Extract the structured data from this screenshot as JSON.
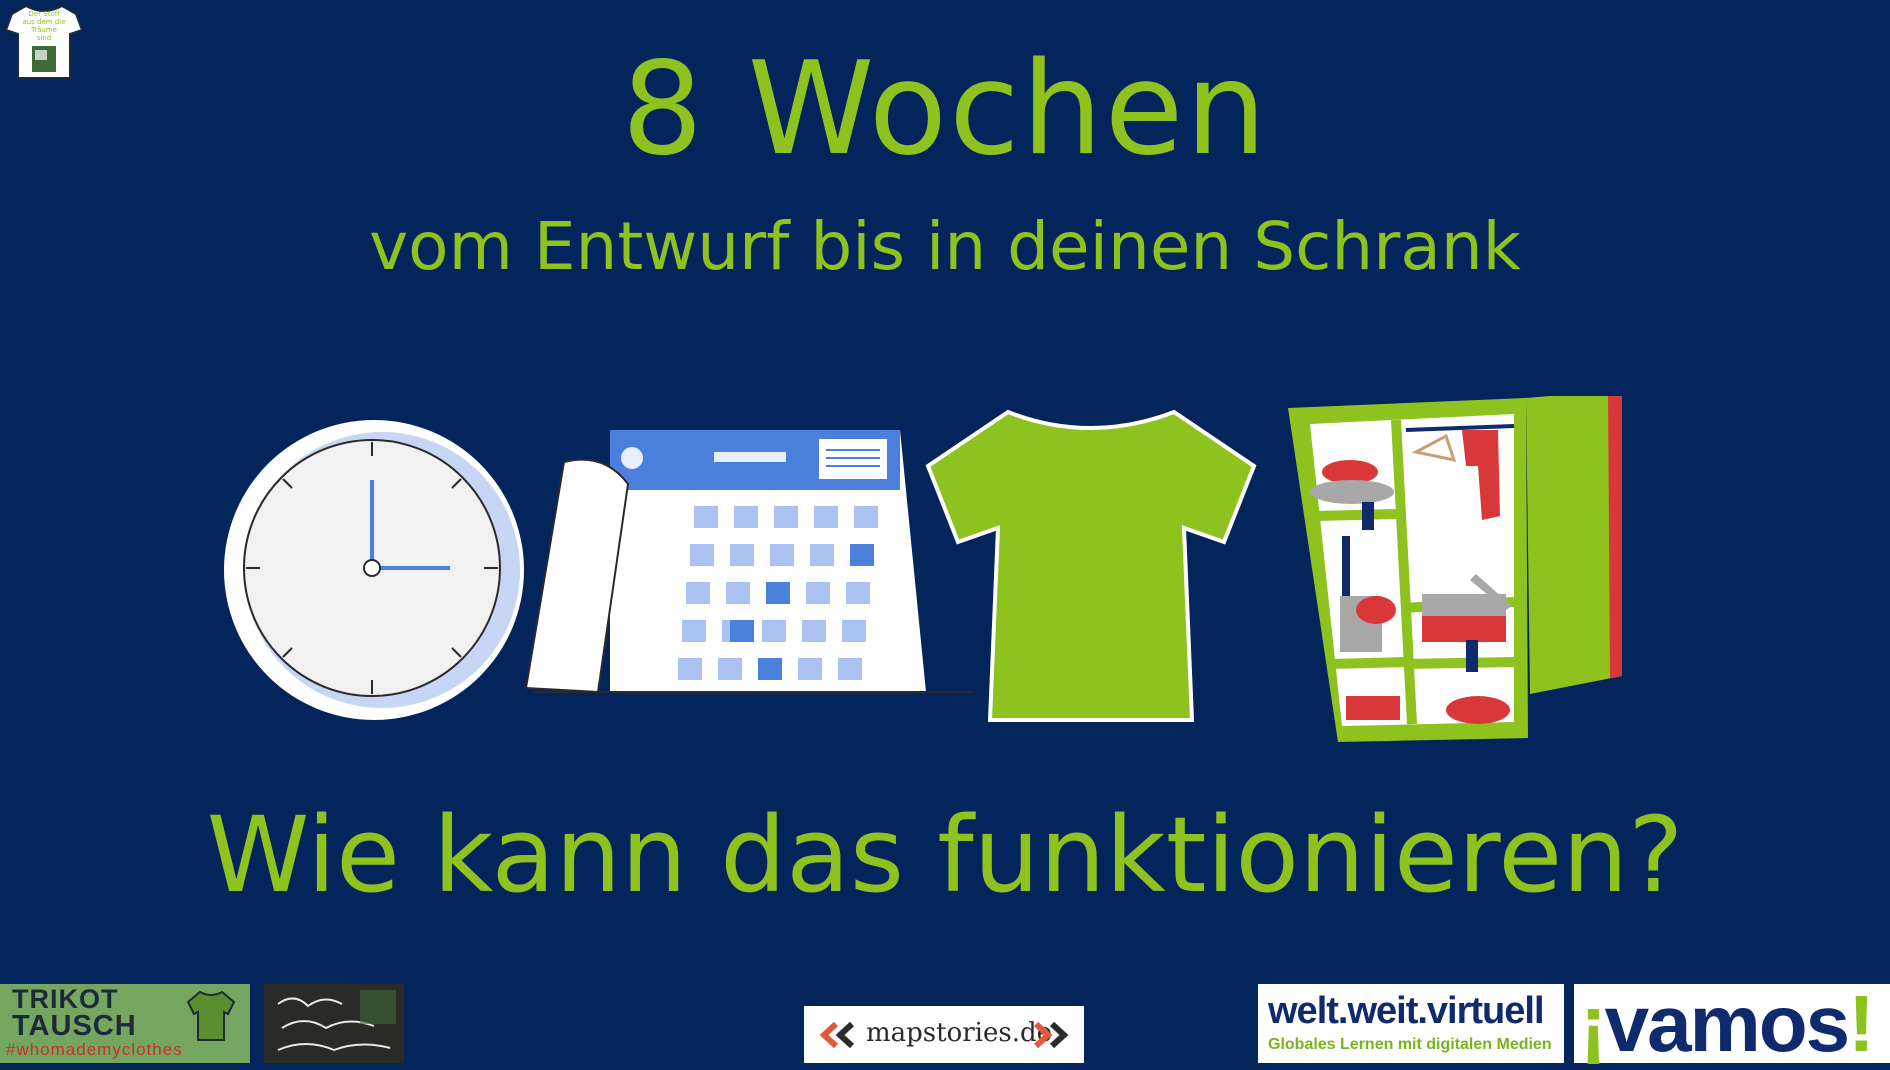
{
  "header": {
    "title": "8 Wochen",
    "subtitle": "vom Entwurf bis in deinen Schrank"
  },
  "question": "Wie kann das funktionieren?",
  "badge": {
    "lines": [
      "Der Stoff",
      "aus dem die",
      "Träume",
      "sind"
    ]
  },
  "illustrations": [
    {
      "name": "clock-icon"
    },
    {
      "name": "calendar-icon"
    },
    {
      "name": "tshirt-icon"
    },
    {
      "name": "wardrobe-icon"
    }
  ],
  "footer": {
    "trikot": {
      "line1": "TRIKOT",
      "line2": "TAUSCH",
      "hashtag": "#whomademyclothes"
    },
    "stoff_logo": "Der Stoff aus dem die Träume sind",
    "mapstories": "mapstories.de",
    "wwv": {
      "title": "welt.weit.virtuell",
      "tagline": "Globales Lernen mit digitalen Medien"
    },
    "vamos": {
      "text": "vamos",
      "open": "¡",
      "close": "!"
    }
  },
  "colors": {
    "background": "#03255c",
    "accent_green": "#8dc21f",
    "calendar_blue": "#4a7fdc",
    "wardrobe_red": "#d8383a"
  }
}
